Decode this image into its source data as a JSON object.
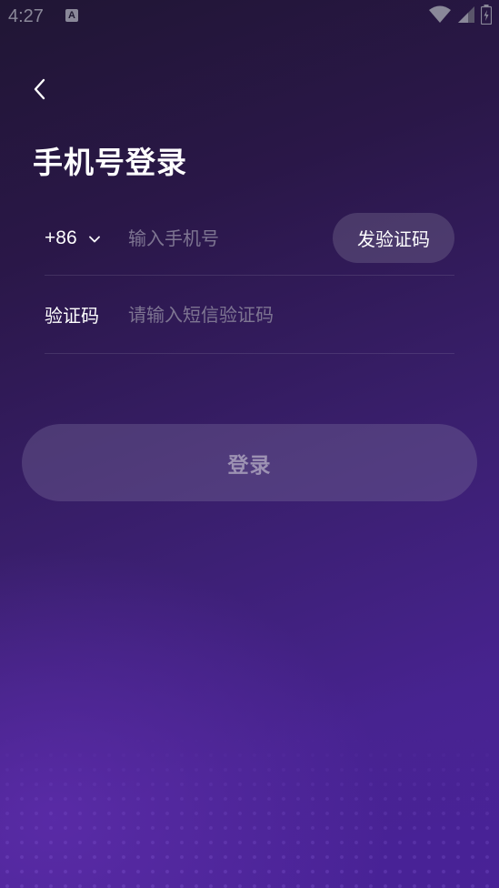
{
  "status_bar": {
    "time": "4:27",
    "notification_icon": "A"
  },
  "header": {
    "back_icon": "chevron-left-icon",
    "title": "手机号登录"
  },
  "phone_row": {
    "country_code": "+86",
    "phone_placeholder": "输入手机号",
    "phone_value": "",
    "send_code_label": "发验证码"
  },
  "code_row": {
    "label": "验证码",
    "code_placeholder": "请输入短信验证码",
    "code_value": ""
  },
  "login_button": {
    "label": "登录"
  },
  "colors": {
    "background_top": "#201634",
    "background_bottom": "#4a2398",
    "placeholder": "#7e7592",
    "login_text": "#9d92b3"
  }
}
